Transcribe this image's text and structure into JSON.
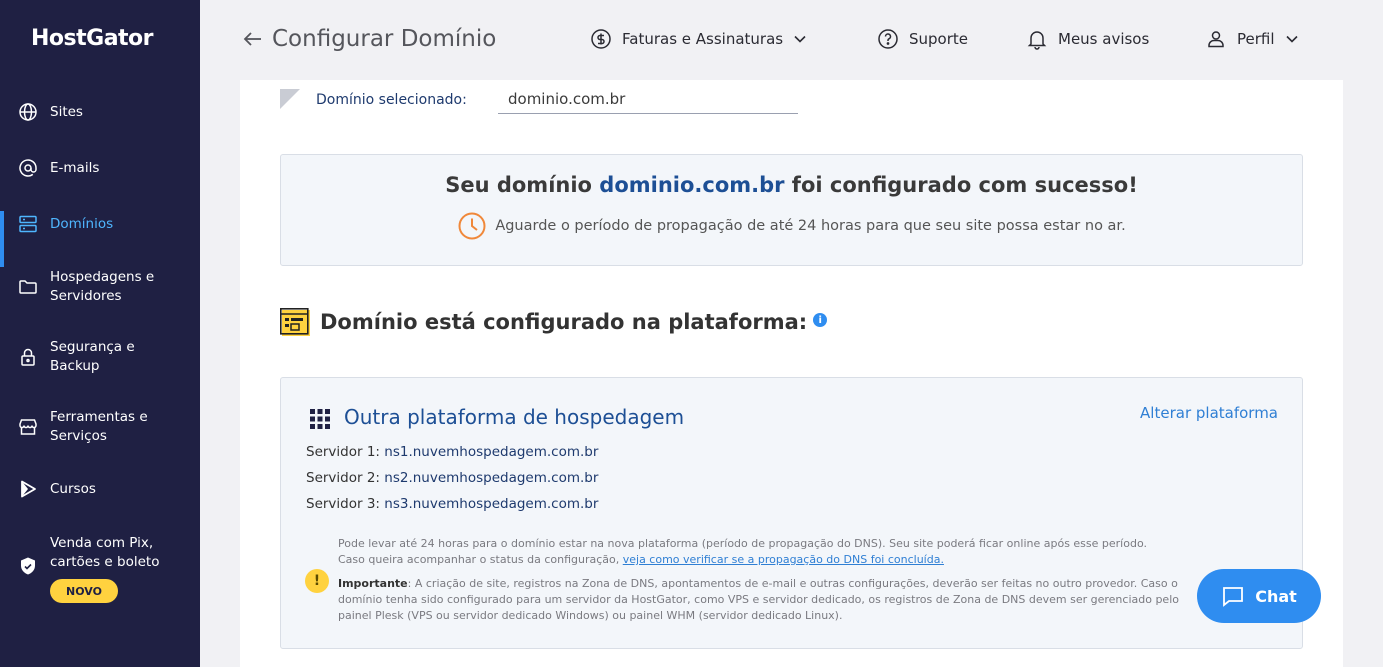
{
  "sidebar": {
    "logo": "HostGator",
    "items": [
      {
        "label": "Sites",
        "icon": "globe-icon"
      },
      {
        "label": "E-mails",
        "icon": "at-icon"
      },
      {
        "label": "Domínios",
        "icon": "server-icon"
      },
      {
        "label": "Hospedagens e Servidores",
        "icon": "folder-icon"
      },
      {
        "label": "Segurança e Backup",
        "icon": "lock-icon"
      },
      {
        "label": "Ferramentas e Serviços",
        "icon": "store-icon"
      },
      {
        "label": "Cursos",
        "icon": "play-icon"
      },
      {
        "label": "Venda com Pix, cartões e boleto",
        "icon": "shield-icon"
      }
    ],
    "new_badge": "NOVO"
  },
  "header": {
    "title": "Configurar Domínio",
    "invoices": "Faturas e Assinaturas",
    "support": "Suporte",
    "notices": "Meus avisos",
    "profile": "Perfil"
  },
  "domain": {
    "label": "Domínio selecionado:",
    "value": "dominio.com.br"
  },
  "success": {
    "prefix": "Seu domínio ",
    "domain": "dominio.com.br",
    "suffix": " foi configurado com sucesso!",
    "subtitle": "Aguarde o período de propagação de até 24 horas para que seu site possa estar no ar."
  },
  "platform": {
    "heading": "Domínio está configurado na plataforma:",
    "info": "i",
    "box_title": "Outra plataforma de hospedagem",
    "change_link": "Alterar plataforma",
    "servers": [
      {
        "label": "Servidor 1: ",
        "value": "ns1.nuvemhospedagem.com.br"
      },
      {
        "label": "Servidor 2: ",
        "value": "ns2.nuvemhospedagem.com.br"
      },
      {
        "label": "Servidor 3: ",
        "value": "ns3.nuvemhospedagem.com.br"
      }
    ],
    "note_line1": "Pode levar até 24 horas para o domínio estar na nova plataforma (período de propagação do DNS). Seu site poderá ficar online após esse período.",
    "note_line2_prefix": "Caso queira acompanhar o status da configuração, ",
    "note_link": "veja como verificar se a propagação do DNS foi concluída.",
    "warn_symbol": "!",
    "important_label": "Importante",
    "important_text": ": A criação de site, registros na Zona de DNS, apontamentos de e-mail e outras configurações, deverão ser feitas no outro provedor. Caso o domínio tenha sido configurado para um servidor da HostGator, como VPS e servidor dedicado, os registros de Zona de DNS devem ser gerenciado pelo painel Plesk (VPS ou servidor dedicado Windows) ou painel WHM (servidor dedicado Linux)."
  },
  "chat": {
    "label": "Chat"
  }
}
